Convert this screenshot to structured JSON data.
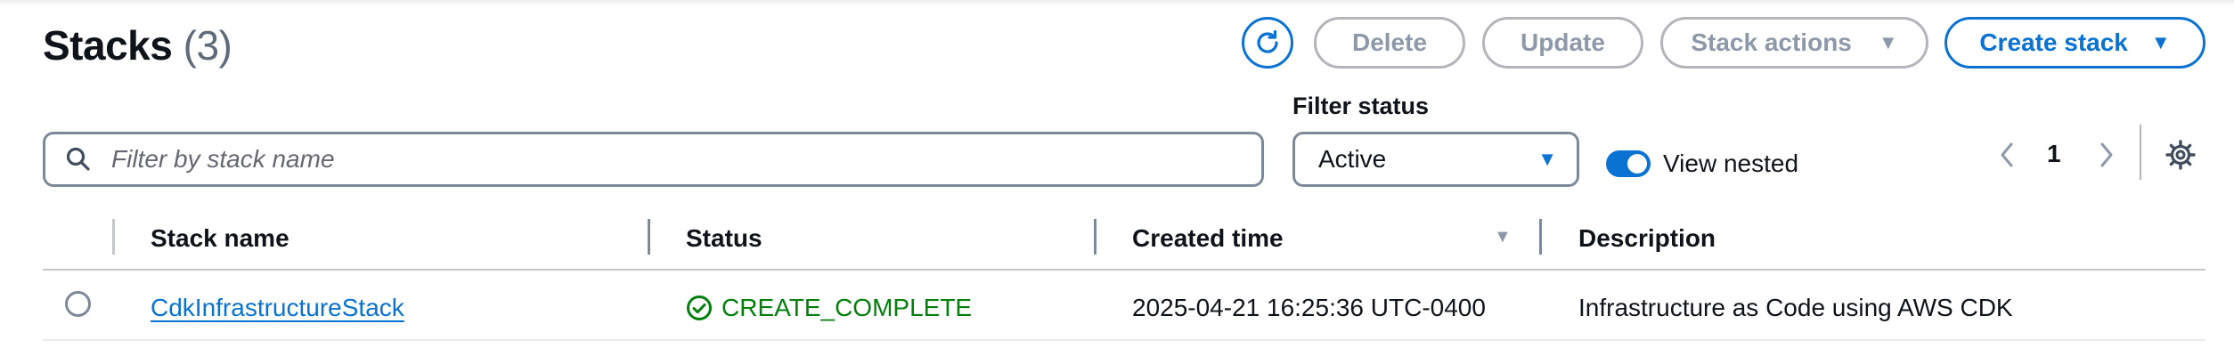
{
  "header": {
    "title": "Stacks",
    "count": "(3)"
  },
  "toolbar": {
    "refresh_icon": "refresh-icon",
    "delete_label": "Delete",
    "update_label": "Update",
    "stack_actions_label": "Stack actions",
    "create_stack_label": "Create stack"
  },
  "filters": {
    "search_placeholder": "Filter by stack name",
    "search_value": "",
    "status_label": "Filter status",
    "status_value": "Active",
    "view_nested_label": "View nested",
    "view_nested_on": true
  },
  "pagination": {
    "current_page": "1"
  },
  "table": {
    "columns": [
      "Stack name",
      "Status",
      "Created time",
      "Description"
    ],
    "sorted_column": "Created time",
    "rows": [
      {
        "stack_name": "CdkInfrastructureStack",
        "status": "CREATE_COMPLETE",
        "created_time": "2025-04-21 16:25:36 UTC-0400",
        "description": "Infrastructure as Code using AWS CDK"
      }
    ]
  },
  "colors": {
    "accent": "#0972d3",
    "success": "#037f0c",
    "disabled": "#8d99a8",
    "border": "#7d8998"
  }
}
